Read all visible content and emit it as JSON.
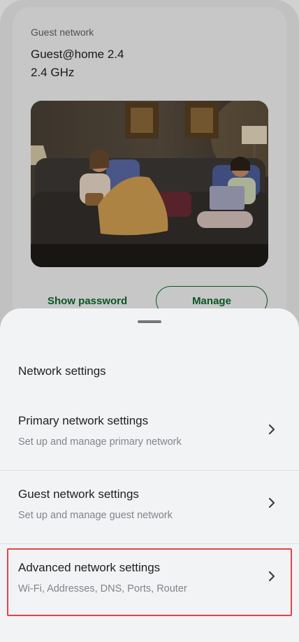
{
  "guest_card": {
    "label": "Guest network",
    "ssid": "Guest@home 2.4",
    "band": "2.4 GHz",
    "show_password_label": "Show password",
    "manage_label": "Manage"
  },
  "sheet": {
    "title": "Network settings",
    "items": [
      {
        "title": "Primary network settings",
        "subtitle": "Set up and manage primary network",
        "icon": "chevron-right-icon"
      },
      {
        "title": "Guest network settings",
        "subtitle": "Set up and manage guest network",
        "icon": "chevron-right-icon"
      },
      {
        "title": "Advanced network settings",
        "subtitle": "Wi-Fi, Addresses, DNS, Ports, Router",
        "icon": "chevron-right-icon"
      }
    ]
  },
  "colors": {
    "accent_green": "#0b6b2b",
    "highlight_red": "#e0454b",
    "sheet_bg": "#f2f3f5"
  }
}
